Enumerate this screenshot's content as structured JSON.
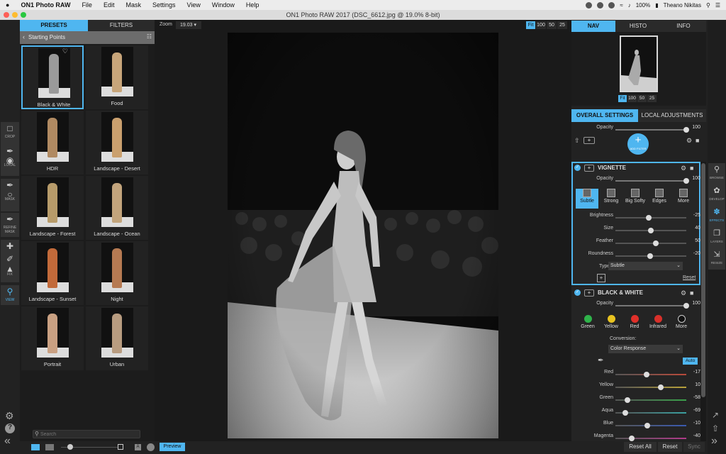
{
  "menubar": {
    "apple": "",
    "app": "ON1 Photo RAW",
    "items": [
      "File",
      "Edit",
      "Mask",
      "Settings",
      "View",
      "Window",
      "Help"
    ],
    "battery": "100%",
    "user": "Theano Nikitas"
  },
  "window": {
    "title": "ON1 Photo RAW 2017 (DSC_6612.jpg @ 19.0% 8-bit)"
  },
  "left": {
    "tabs": [
      "PRESETS",
      "FILTERS"
    ],
    "breadcrumb": "Starting Points",
    "presets": [
      {
        "label": "Black & White",
        "color": "#9a9a9a"
      },
      {
        "label": "Food",
        "color": "#c7a57a"
      },
      {
        "label": "HDR",
        "color": "#b08a62"
      },
      {
        "label": "Landscape - Desert",
        "color": "#caa06e"
      },
      {
        "label": "Landscape - Forest",
        "color": "#b79b6a"
      },
      {
        "label": "Landscape - Ocean",
        "color": "#c2a47c"
      },
      {
        "label": "Landscape - Sunset",
        "color": "#c26a3a"
      },
      {
        "label": "Night",
        "color": "#b67a52"
      },
      {
        "label": "Portrait",
        "color": "#c9a082"
      },
      {
        "label": "Urban",
        "color": "#b89c80"
      }
    ],
    "search_placeholder": "Search"
  },
  "tools": [
    "CROP",
    "LOCAL",
    "MASK",
    "REFINE MASK",
    "FIX",
    "VIEW"
  ],
  "zoom": {
    "label": "Zoom",
    "value": "19.03",
    "fit": "Fit",
    "z100": "100",
    "z50": "50",
    "z25": "25"
  },
  "bottom": {
    "preview": "Preview",
    "reset_all": "Reset All",
    "reset": "Reset",
    "sync": "Sync"
  },
  "nav": {
    "tabs": [
      "NAV",
      "HISTO",
      "INFO"
    ],
    "fit": "Fit",
    "z100": "100",
    "z50": "50",
    "z25": "25"
  },
  "settings_tabs": [
    "OVERALL SETTINGS",
    "LOCAL ADJUSTMENTS"
  ],
  "overall": {
    "opacity_label": "Opacity",
    "opacity": "100",
    "add_filter": "ADD FILTER"
  },
  "vignette": {
    "title": "VIGNETTE",
    "opacity_label": "Opacity",
    "opacity": "100",
    "presets": [
      "Subtle",
      "Strong",
      "Big Softy",
      "Edges",
      "More"
    ],
    "sliders": [
      {
        "label": "Brightness",
        "value": "-25",
        "pos": 0.45
      },
      {
        "label": "Size",
        "value": "40",
        "pos": 0.48
      },
      {
        "label": "Feather",
        "value": "50",
        "pos": 0.55
      },
      {
        "label": "Roundness",
        "value": "-20",
        "pos": 0.47
      }
    ],
    "type_label": "Type",
    "type_value": "Subtle",
    "reset": "Reset"
  },
  "bw": {
    "title": "BLACK & WHITE",
    "opacity_label": "Opacity",
    "opacity": "100",
    "swatches": [
      {
        "label": "Green",
        "color": "#2fb34a"
      },
      {
        "label": "Yellow",
        "color": "#e8c320"
      },
      {
        "label": "Red",
        "color": "#e0302a"
      },
      {
        "label": "Infrared",
        "color": "#d8302a"
      },
      {
        "label": "More",
        "color": "#111111"
      }
    ],
    "conversion_label": "Conversion:",
    "conversion": "Color Response",
    "auto": "Auto",
    "sliders": [
      {
        "label": "Red",
        "value": "-17",
        "pos": 0.42,
        "color": "#b94a3a"
      },
      {
        "label": "Yellow",
        "value": "10",
        "pos": 0.62,
        "color": "#b9a23a"
      },
      {
        "label": "Green",
        "value": "-58",
        "pos": 0.14,
        "color": "#3aa04a"
      },
      {
        "label": "Aqua",
        "value": "-69",
        "pos": 0.1,
        "color": "#3aa0a0"
      },
      {
        "label": "Blue",
        "value": "-10",
        "pos": 0.43,
        "color": "#3a5ab0"
      },
      {
        "label": "Magenta",
        "value": "-40",
        "pos": 0.2,
        "color": "#b03a8a"
      }
    ]
  },
  "right_tools": [
    "BROWSE",
    "DEVELOP",
    "EFFECTS",
    "LAYERS",
    "RESIZE"
  ]
}
